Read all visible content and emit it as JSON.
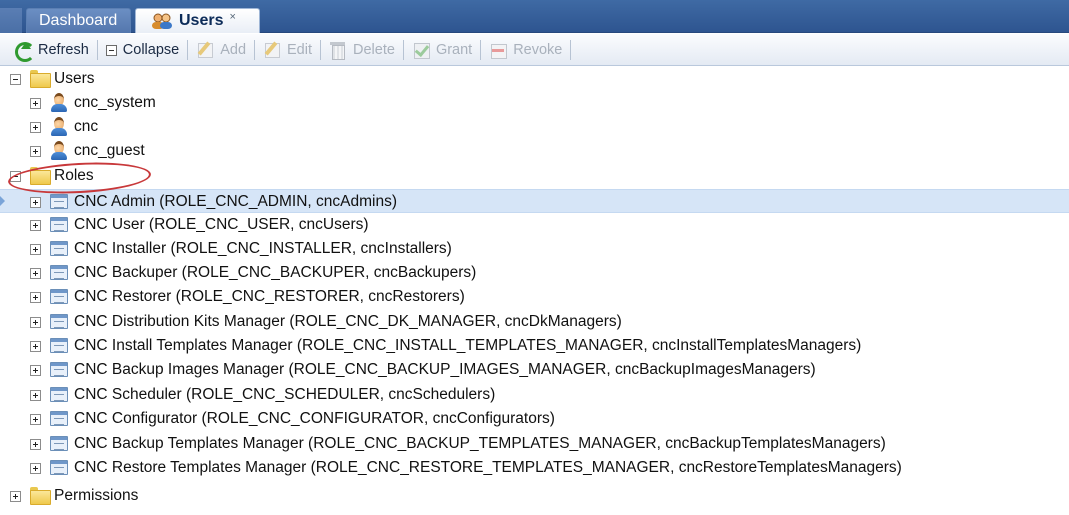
{
  "tabs": [
    {
      "label": "Dashboard",
      "active": false
    },
    {
      "label": "Users",
      "active": true,
      "close": "×"
    }
  ],
  "toolbar": {
    "buttons": [
      {
        "label": "Refresh",
        "icon": "refresh-icon",
        "enabled": true
      },
      {
        "label": "Collapse",
        "icon": "collapse-icon",
        "enabled": true
      },
      {
        "label": "Add",
        "icon": "add-icon",
        "enabled": false
      },
      {
        "label": "Edit",
        "icon": "edit-icon",
        "enabled": false
      },
      {
        "label": "Delete",
        "icon": "delete-icon",
        "enabled": false
      },
      {
        "label": "Grant",
        "icon": "grant-icon",
        "enabled": false
      },
      {
        "label": "Revoke",
        "icon": "revoke-icon",
        "enabled": false
      }
    ]
  },
  "tree": {
    "users_folder": "Users",
    "users": [
      "cnc_system",
      "cnc",
      "cnc_guest"
    ],
    "roles_folder": "Roles",
    "roles": [
      "CNC Admin (ROLE_CNC_ADMIN, cncAdmins)",
      "CNC User (ROLE_CNC_USER, cncUsers)",
      "CNC Installer (ROLE_CNC_INSTALLER, cncInstallers)",
      "CNC Backuper (ROLE_CNC_BACKUPER, cncBackupers)",
      "CNC Restorer (ROLE_CNC_RESTORER, cncRestorers)",
      "CNC Distribution Kits Manager (ROLE_CNC_DK_MANAGER, cncDkManagers)",
      "CNC Install Templates Manager (ROLE_CNC_INSTALL_TEMPLATES_MANAGER, cncInstallTemplatesManagers)",
      "CNC Backup Images Manager (ROLE_CNC_BACKUP_IMAGES_MANAGER, cncBackupImagesManagers)",
      "CNC Scheduler (ROLE_CNC_SCHEDULER, cncSchedulers)",
      "CNC Configurator (ROLE_CNC_CONFIGURATOR, cncConfigurators)",
      "CNC Backup Templates Manager (ROLE_CNC_BACKUP_TEMPLATES_MANAGER, cncBackupTemplatesManagers)",
      "CNC Restore Templates Manager (ROLE_CNC_RESTORE_TEMPLATES_MANAGER, cncRestoreTemplatesManagers)"
    ],
    "selected_role_index": 0,
    "permissions_folder": "Permissions"
  },
  "colors": {
    "tab_bar": "#2e5590",
    "selection": "#d6e5f7",
    "annotation": "#c8383a"
  }
}
